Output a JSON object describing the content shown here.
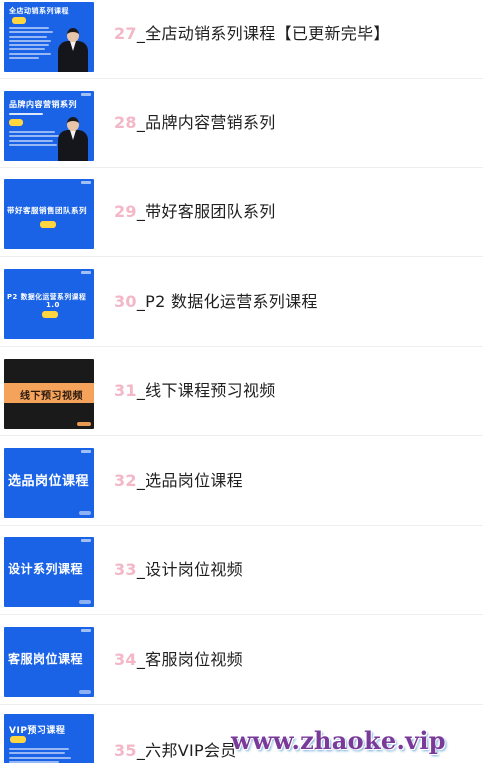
{
  "courses": [
    {
      "num": "27",
      "title": "_全店动销系列课程【已更新完毕】",
      "thumb_title": "全店动销系列课程"
    },
    {
      "num": "28",
      "title": "_品牌内容营销系列",
      "thumb_title": "品牌内容营销系列"
    },
    {
      "num": "29",
      "title": "_带好客服团队系列",
      "thumb_title": "带好客服销售团队系列"
    },
    {
      "num": "30",
      "title": "_P2 数据化运营系列课程",
      "thumb_title": "P2 数据化运营系列课程",
      "thumb_sub": "1.0"
    },
    {
      "num": "31",
      "title": "_线下课程预习视频",
      "thumb_title": "线下预习视频"
    },
    {
      "num": "32",
      "title": "_选品岗位课程",
      "thumb_title": "选品岗位课程"
    },
    {
      "num": "33",
      "title": "_设计岗位视频",
      "thumb_title": "设计系列课程"
    },
    {
      "num": "34",
      "title": "_客服岗位视频",
      "thumb_title": "客服岗位课程"
    },
    {
      "num": "35",
      "title": "_六邦VIP会员",
      "thumb_title": "VIP预习课程"
    }
  ],
  "watermark": "www.zhaoke.vip"
}
